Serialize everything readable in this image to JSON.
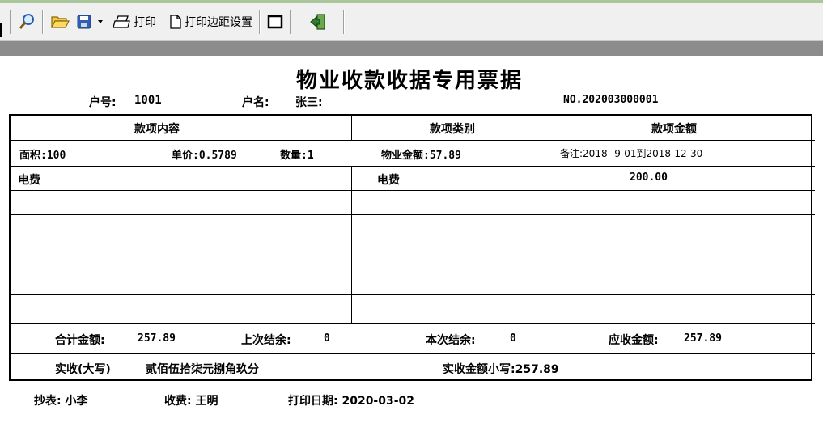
{
  "toolbar": {
    "print_label": "打印",
    "margin_label": "打印边距设置"
  },
  "receipt": {
    "title": "物业收款收据专用票据",
    "account_no_label": "户号:",
    "account_no": "1001",
    "account_name_label": "户名:",
    "account_name": "张三:",
    "serial": "NO.202003000001",
    "headers": [
      "款项内容",
      "款项类别",
      "款项金额"
    ],
    "info": {
      "area": "面积:100",
      "unit_price": "单价:0.5789",
      "quantity": "数量:1",
      "property_amount": "物业金额:57.89",
      "remark": "备注:2018--9-01到2018-12-30"
    },
    "row1": {
      "content": "电费",
      "category": "电费",
      "amount": "200.00"
    },
    "totals": {
      "total_label": "合计金额:",
      "total": "257.89",
      "last_balance_label": "上次结余:",
      "last_balance": "0",
      "this_balance_label": "本次结余:",
      "this_balance": "0",
      "due_label": "应收金额:",
      "due": "257.89"
    },
    "paid": {
      "upper_label": "实收(大写)",
      "upper_value": "贰佰伍拾柒元捌角玖分",
      "lower": "实收金额小写:257.89"
    },
    "footer": {
      "copier": "抄表: 小李",
      "collector": "收费: 王明",
      "print_date": "打印日期: 2020-03-02"
    }
  }
}
